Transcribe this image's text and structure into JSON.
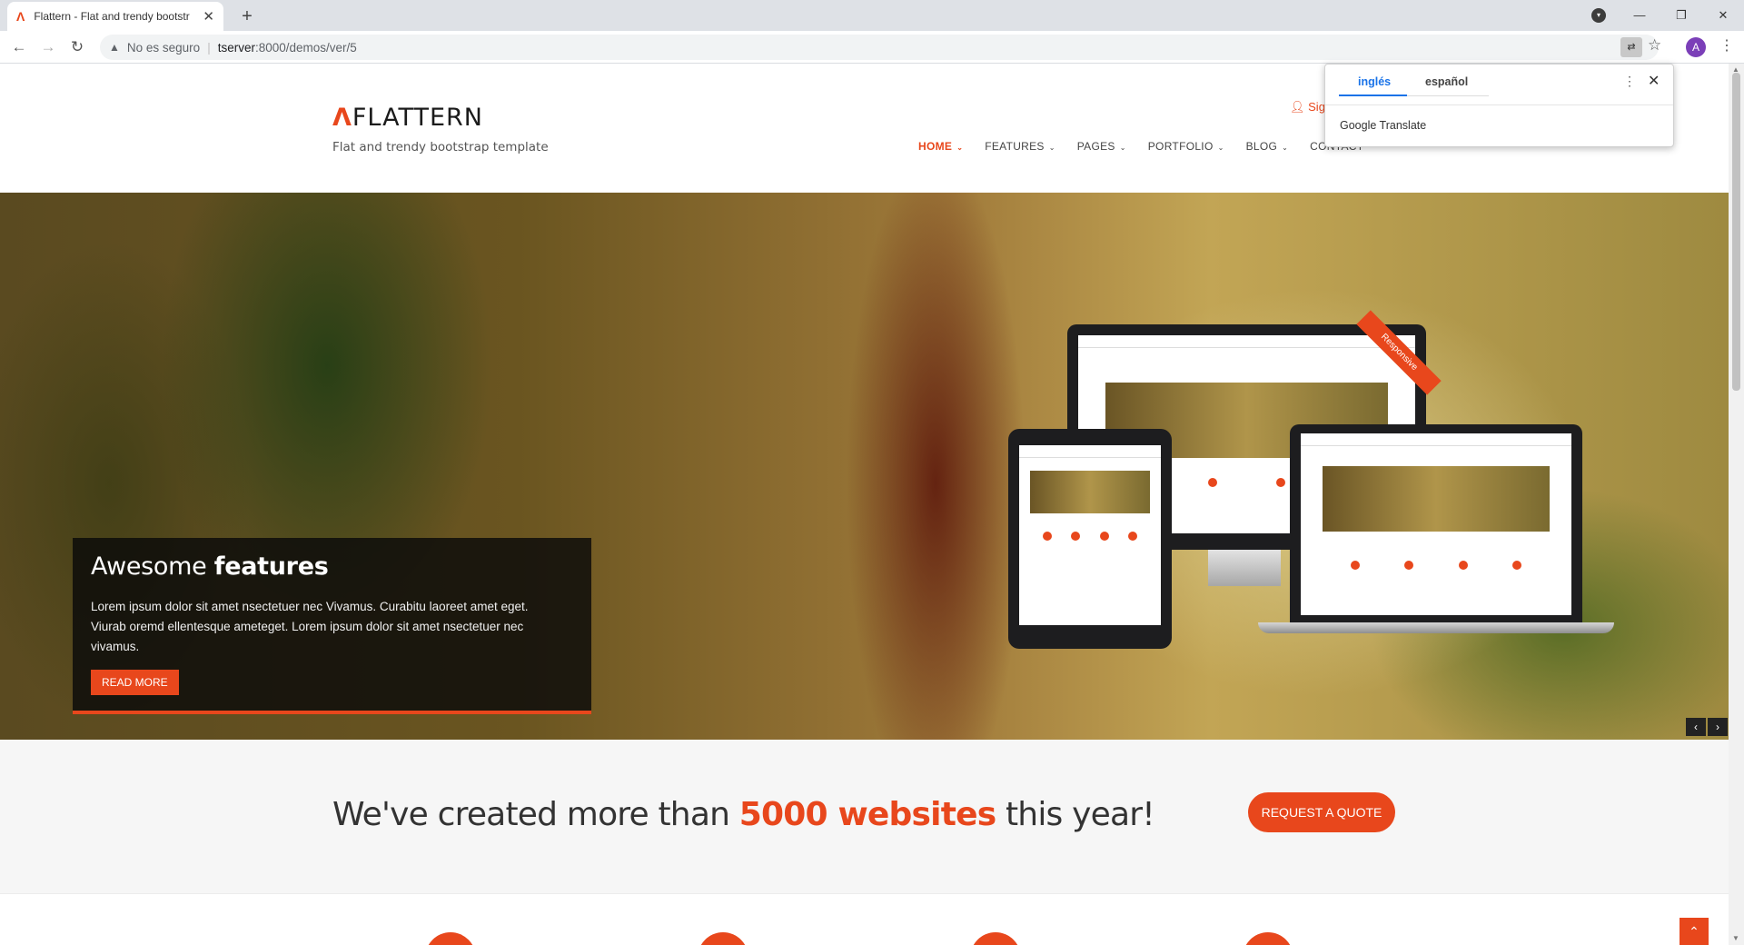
{
  "browser": {
    "tab_title": "Flattern - Flat and trendy bootstr",
    "tab_close": "✕",
    "new_tab": "+",
    "security_warning": "No es seguro",
    "url_host": "tserver",
    "url_path": ":8000/demos/ver/5",
    "avatar_initial": "A"
  },
  "translate_popup": {
    "lang_selected": "inglés",
    "lang_other": "español",
    "brand": "Google Translate"
  },
  "site": {
    "logo_mark": "Λ",
    "logo_text": "FLATTERN",
    "tagline": "Flat and trendy bootstrap template",
    "signup": "Sig",
    "nav": [
      {
        "label": "HOME",
        "caret": "⌄"
      },
      {
        "label": "FEATURES",
        "caret": "⌄"
      },
      {
        "label": "PAGES",
        "caret": "⌄"
      },
      {
        "label": "PORTFOLIO",
        "caret": "⌄"
      },
      {
        "label": "BLOG",
        "caret": "⌄"
      },
      {
        "label": "CONTACT",
        "caret": ""
      }
    ]
  },
  "hero": {
    "title_light": "Awesome ",
    "title_bold": "features",
    "body": "Lorem ipsum dolor sit amet nsectetuer nec Vivamus. Curabitu laoreet amet eget. Viurab oremd ellentesque ameteget. Lorem ipsum dolor sit amet nsectetuer nec vivamus.",
    "button": "READ MORE",
    "ribbon": "Responsive",
    "prev": "‹",
    "next": "›"
  },
  "cta": {
    "text_before": "We've created more than ",
    "text_highlight": "5000 websites",
    "text_after": " this year!",
    "button": "REQUEST A QUOTE"
  },
  "colors": {
    "accent": "#e8471c",
    "link_blue": "#1a73e8"
  }
}
